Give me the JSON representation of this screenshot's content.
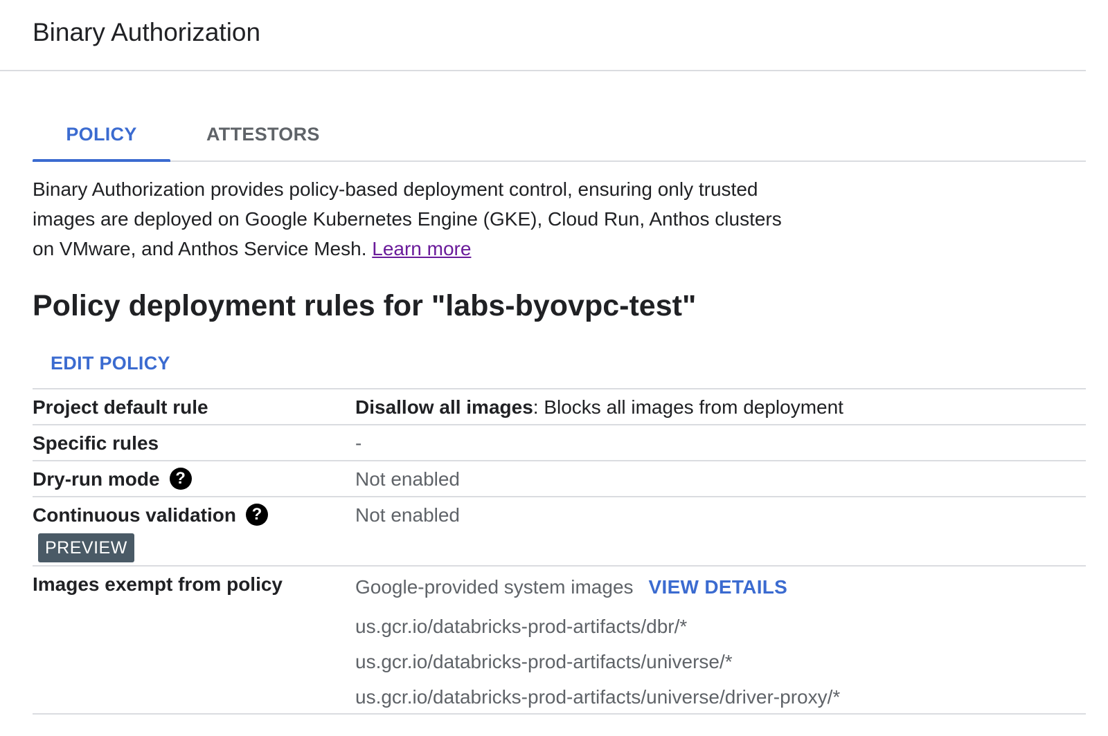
{
  "header": {
    "title": "Binary Authorization"
  },
  "tabs": [
    {
      "label": "POLICY",
      "active": true
    },
    {
      "label": "ATTESTORS",
      "active": false
    }
  ],
  "description": {
    "text": "Binary Authorization provides policy-based deployment control, ensuring only trusted images are deployed on Google Kubernetes Engine (GKE), Cloud Run, Anthos clusters on VMware, and Anthos Service Mesh. ",
    "link": "Learn more"
  },
  "policy": {
    "heading": "Policy deployment rules for \"labs-byovpc-test\"",
    "edit_label": "EDIT POLICY",
    "rows": {
      "project_default": {
        "label": "Project default rule",
        "value_bold": "Disallow all images",
        "value_rest": ": Blocks all images from deployment"
      },
      "specific_rules": {
        "label": "Specific rules",
        "value": "-"
      },
      "dry_run": {
        "label": "Dry-run mode",
        "value": "Not enabled"
      },
      "continuous_validation": {
        "label": "Continuous validation",
        "value": "Not enabled",
        "badge": "PREVIEW"
      },
      "exempt": {
        "label": "Images exempt from policy",
        "system_images": "Google-provided system images",
        "view_details": "VIEW DETAILS",
        "paths": [
          "us.gcr.io/databricks-prod-artifacts/dbr/*",
          "us.gcr.io/databricks-prod-artifacts/universe/*",
          "us.gcr.io/databricks-prod-artifacts/universe/driver-proxy/*"
        ]
      }
    }
  },
  "colors": {
    "accent": "#3b6bd0",
    "link_visited": "#6a1b9a",
    "badge_bg": "#4a5a66",
    "divider": "#dadce0"
  },
  "icons": {
    "help": "help-circle-icon"
  }
}
